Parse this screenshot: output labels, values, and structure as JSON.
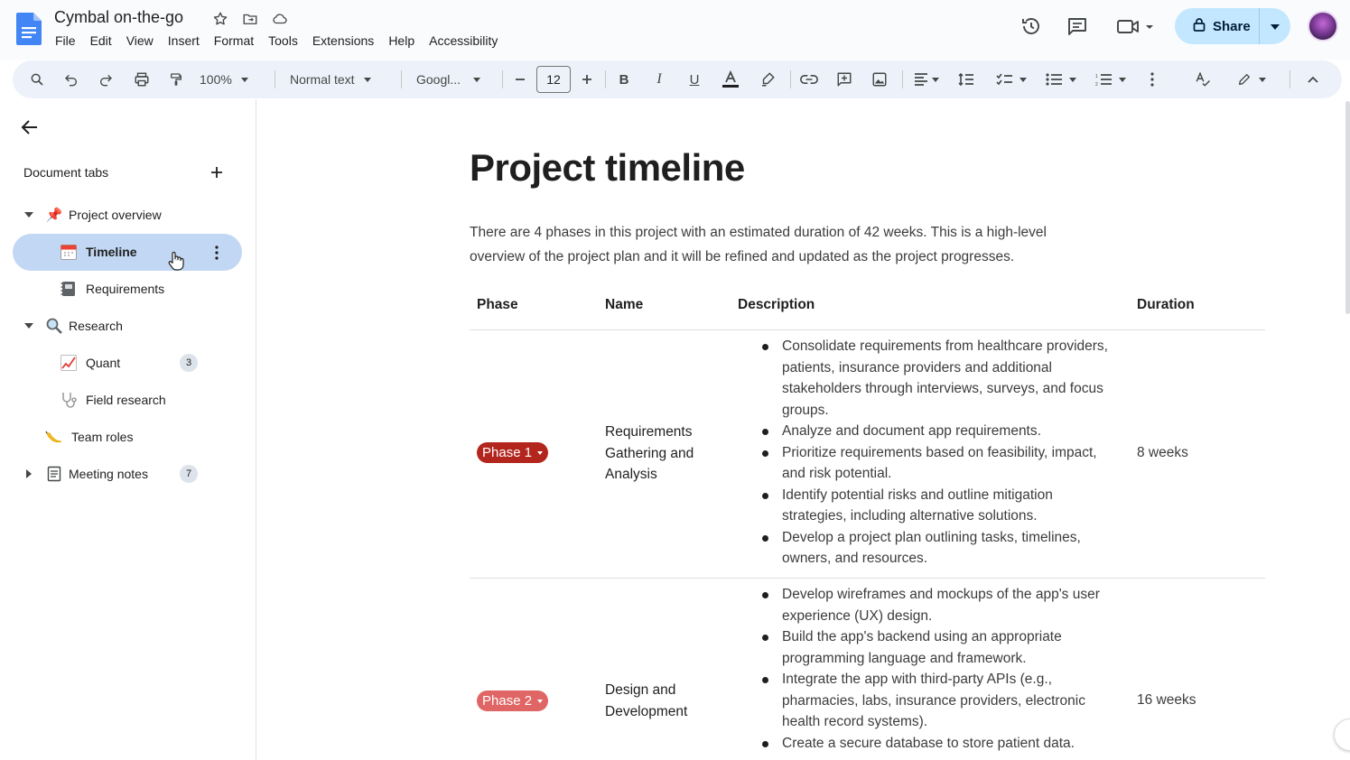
{
  "app": {
    "doc_title": "Cymbal on-the-go",
    "menu": [
      "File",
      "Edit",
      "View",
      "Insert",
      "Format",
      "Tools",
      "Extensions",
      "Help",
      "Accessibility"
    ],
    "share_label": "Share"
  },
  "toolbar": {
    "zoom": "100%",
    "style": "Normal text",
    "font": "Googl...",
    "font_size": "12"
  },
  "sidebar": {
    "heading": "Document tabs",
    "items": [
      {
        "label": "Project overview",
        "icon": "pushpin-icon",
        "emoji": "📌"
      },
      {
        "label": "Timeline",
        "icon": "calendar-icon",
        "emoji": "📅"
      },
      {
        "label": "Requirements",
        "icon": "notebook-icon",
        "emoji": "📓"
      },
      {
        "label": "Research",
        "icon": "magnifier-icon",
        "emoji": "🔍"
      },
      {
        "label": "Quant",
        "icon": "chart-increasing-icon",
        "emoji": "📈",
        "count": "3"
      },
      {
        "label": "Field research",
        "icon": "stethoscope-icon",
        "emoji": "🩺"
      },
      {
        "label": "Team roles",
        "icon": "banana-icon",
        "emoji": "🍌"
      },
      {
        "label": "Meeting notes",
        "icon": "document-icon",
        "emoji": "▤",
        "count": "7"
      }
    ]
  },
  "document": {
    "heading": "Project timeline",
    "intro": "There are 4 phases in this project with an estimated duration of 42 weeks. This is a high-level overview of the project plan and it will be refined and updated as the project progresses.",
    "table": {
      "headers": [
        "Phase",
        "Name",
        "Description",
        "Duration"
      ],
      "rows": [
        {
          "phase": "Phase 1",
          "phase_color": "#b3261e",
          "name": "Requirements Gathering and Analysis",
          "bullets": [
            "Consolidate requirements from healthcare providers, patients, insurance providers and additional stakeholders through interviews, surveys, and focus groups.",
            "Analyze and document app requirements.",
            "Prioritize requirements based on feasibility, impact, and risk potential.",
            "Identify potential risks and outline mitigation strategies, including alternative solutions.",
            "Develop a project plan outlining tasks, timelines, owners, and resources."
          ],
          "duration": "8 weeks"
        },
        {
          "phase": "Phase 2",
          "phase_color": "#e06666",
          "name": "Design and Development",
          "bullets": [
            "Develop wireframes and mockups of the app's user experience (UX) design.",
            "Build the app's backend using an appropriate programming language and framework.",
            "Integrate the app with third-party APIs (e.g., pharmacies, labs, insurance providers, electronic health record systems).",
            "Create a secure database to store patient data."
          ],
          "duration": "16 weeks"
        }
      ]
    }
  },
  "colors": {
    "share_bg": "#c2e7ff",
    "toolbar_bg": "#edf2fa",
    "active_tab_bg": "#c2d7f3",
    "docs_blue": "#4285f4"
  }
}
